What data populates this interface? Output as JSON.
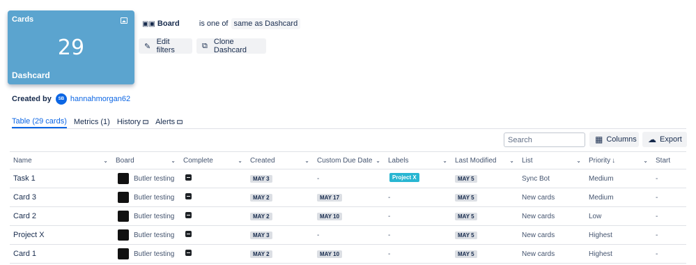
{
  "dashcard": {
    "title": "Cards",
    "count": "29",
    "name": "Dashcard",
    "icon": "image-icon",
    "color": "#5ba4cf"
  },
  "filter": {
    "icon": "board-icon",
    "field": "Board",
    "operator": "is one of",
    "value": "same as Dashcard"
  },
  "actions": {
    "edit_filters": "Edit filters",
    "clone_dashcard": "Clone Dashcard"
  },
  "created_by": {
    "label": "Created by",
    "initials": "SB",
    "username": "hannahmorgan62"
  },
  "tabs": [
    {
      "label": "Table (29 cards)",
      "active": true
    },
    {
      "label": "Metrics (1)",
      "active": false
    },
    {
      "label": "History",
      "active": false,
      "locked": true
    },
    {
      "label": "Alerts",
      "active": false,
      "locked": true
    }
  ],
  "toolbar": {
    "search_placeholder": "Search",
    "columns_label": "Columns",
    "export_label": "Export"
  },
  "table": {
    "columns": [
      "Name",
      "Board",
      "Complete",
      "Created",
      "Custom Due Date",
      "Labels",
      "Last Modified",
      "List",
      "Priority",
      "Start"
    ],
    "sorted_column": "Priority",
    "rows": [
      {
        "name": "Task 1",
        "board": "Butler testing",
        "complete": "",
        "created": "MAY 3",
        "due": "-",
        "label": "Project X",
        "modified": "MAY 5",
        "list": "Sync Bot",
        "priority": "Medium",
        "start": "-"
      },
      {
        "name": "Card 3",
        "board": "Butler testing",
        "complete": "",
        "created": "MAY 2",
        "due": "MAY 17",
        "label": "-",
        "modified": "MAY 5",
        "list": "New cards",
        "priority": "Medium",
        "start": "-"
      },
      {
        "name": "Card 2",
        "board": "Butler testing",
        "complete": "",
        "created": "MAY 2",
        "due": "MAY 10",
        "label": "-",
        "modified": "MAY 5",
        "list": "New cards",
        "priority": "Low",
        "start": "-"
      },
      {
        "name": "Project X",
        "board": "Butler testing",
        "complete": "",
        "created": "MAY 3",
        "due": "-",
        "label": "-",
        "modified": "MAY 5",
        "list": "New cards",
        "priority": "Highest",
        "start": "-"
      },
      {
        "name": "Card 1",
        "board": "Butler testing",
        "complete": "",
        "created": "MAY 2",
        "due": "MAY 10",
        "label": "-",
        "modified": "MAY 5",
        "list": "New cards",
        "priority": "Highest",
        "start": "-"
      }
    ]
  }
}
